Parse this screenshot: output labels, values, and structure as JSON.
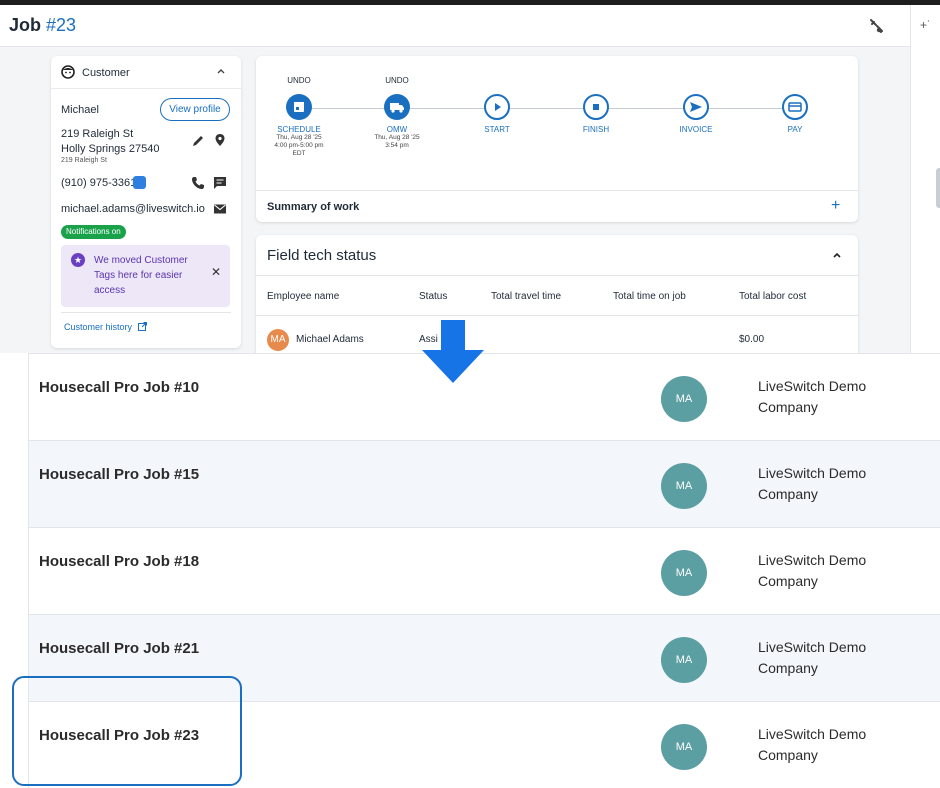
{
  "header": {
    "job_label": "Job",
    "job_number": "#23"
  },
  "customer": {
    "title": "Customer",
    "name": "Michael",
    "view_profile": "View profile",
    "address_line1": "219 Raleigh St",
    "address_line2": "Holly Springs 27540",
    "address_line3": "219 Raleigh St",
    "phone": "(910) 975-3361",
    "email": "michael.adams@liveswitch.io",
    "notifications": "Notifications on",
    "tags_message": "We moved Customer Tags here for easier access",
    "history_link": "Customer history"
  },
  "workflow": {
    "steps": [
      {
        "undo": "UNDO",
        "label": "SCHEDULE",
        "sub1": "Thu, Aug 28 '25",
        "sub2": "4:00 pm-5:00 pm",
        "sub3": "EDT"
      },
      {
        "undo": "UNDO",
        "label": "OMW",
        "sub1": "Thu, Aug 28 '25",
        "sub2": "3:54 pm",
        "sub3": ""
      },
      {
        "undo": "",
        "label": "START",
        "sub1": "",
        "sub2": "",
        "sub3": ""
      },
      {
        "undo": "",
        "label": "FINISH",
        "sub1": "",
        "sub2": "",
        "sub3": ""
      },
      {
        "undo": "",
        "label": "INVOICE",
        "sub1": "",
        "sub2": "",
        "sub3": ""
      },
      {
        "undo": "",
        "label": "PAY",
        "sub1": "",
        "sub2": "",
        "sub3": ""
      }
    ],
    "summary_label": "Summary of work",
    "summary_plus": "+"
  },
  "field_tech": {
    "title": "Field tech status",
    "columns": [
      "Employee name",
      "Status",
      "Total travel time",
      "Total time on job",
      "Total labor cost"
    ],
    "row": {
      "initials": "MA",
      "name": "Michael Adams",
      "status": "Assi",
      "labor_cost": "$0.00"
    }
  },
  "jobs_list": [
    {
      "title": "Housecall Pro Job #10",
      "initials": "MA",
      "company": "LiveSwitch Demo Company"
    },
    {
      "title": "Housecall Pro Job #15",
      "initials": "MA",
      "company": "LiveSwitch Demo Company"
    },
    {
      "title": "Housecall Pro Job #18",
      "initials": "MA",
      "company": "LiveSwitch Demo Company"
    },
    {
      "title": "Housecall Pro Job #21",
      "initials": "MA",
      "company": "LiveSwitch Demo Company"
    },
    {
      "title": "Housecall Pro Job #23",
      "initials": "MA",
      "company": "LiveSwitch Demo Company"
    }
  ],
  "colors": {
    "accent": "#1a6fc1",
    "arrow": "#1774e6",
    "avatar": "#5c9fa3",
    "notif": "#19a24a"
  }
}
